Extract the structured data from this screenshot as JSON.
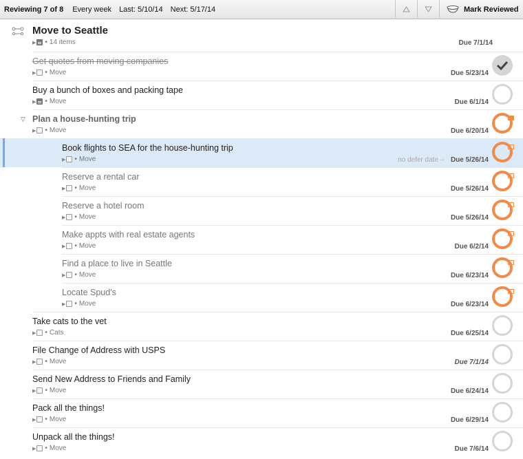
{
  "toolbar": {
    "reviewing": "Reviewing 7 of 8",
    "interval": "Every week",
    "last": "Last: 5/10/14",
    "next": "Next: 5/17/14",
    "mark_reviewed": "Mark Reviewed"
  },
  "project": {
    "title": "Move to Seattle",
    "items": "14 items",
    "due": "Due 7/1/14"
  },
  "tasks": [
    {
      "title": "Get quotes from moving companies",
      "context": "Move",
      "due": "Due 5/23/14",
      "state": "completed"
    },
    {
      "title": "Buy a bunch of boxes and packing tape",
      "context": "Move",
      "due": "Due 6/1/14",
      "state": "available"
    },
    {
      "title": "Plan a house-hunting trip",
      "context": "Move",
      "due": "Due 6/20/14",
      "state": "group"
    },
    {
      "title": "Book flights to SEA for the house-hunting trip",
      "context": "Move",
      "defer": "no defer date",
      "due": "Due 5/26/14",
      "state": "selected"
    },
    {
      "title": "Reserve a rental car",
      "context": "Move",
      "due": "Due 5/26/14",
      "state": "flagged"
    },
    {
      "title": "Reserve a hotel room",
      "context": "Move",
      "due": "Due 5/26/14",
      "state": "flagged"
    },
    {
      "title": "Make appts with real estate agents",
      "context": "Move",
      "due": "Due 6/2/14",
      "state": "flagged"
    },
    {
      "title": "Find a place to live in Seattle",
      "context": "Move",
      "due": "Due 6/23/14",
      "state": "flagged"
    },
    {
      "title": "Locate Spud's",
      "context": "Move",
      "due": "Due 6/23/14",
      "state": "flagged"
    },
    {
      "title": "Take cats to the vet",
      "context": "Cats",
      "due": "Due 6/25/14",
      "state": "available"
    },
    {
      "title": "File Change of Address with USPS",
      "context": "Move",
      "due": "Due 7/1/14",
      "state": "available"
    },
    {
      "title": "Send New Address to Friends and Family",
      "context": "Move",
      "due": "Due 6/24/14",
      "state": "available"
    },
    {
      "title": "Pack all the things!",
      "context": "Move",
      "due": "Due 6/29/14",
      "state": "available"
    },
    {
      "title": "Unpack all the things!",
      "context": "Move",
      "due": "Due 7/6/14",
      "state": "available"
    }
  ],
  "colors": {
    "flag_orange": "#f08b4a",
    "selection_blue": "#dce9f7",
    "circle_gray": "#d5d5d5"
  }
}
